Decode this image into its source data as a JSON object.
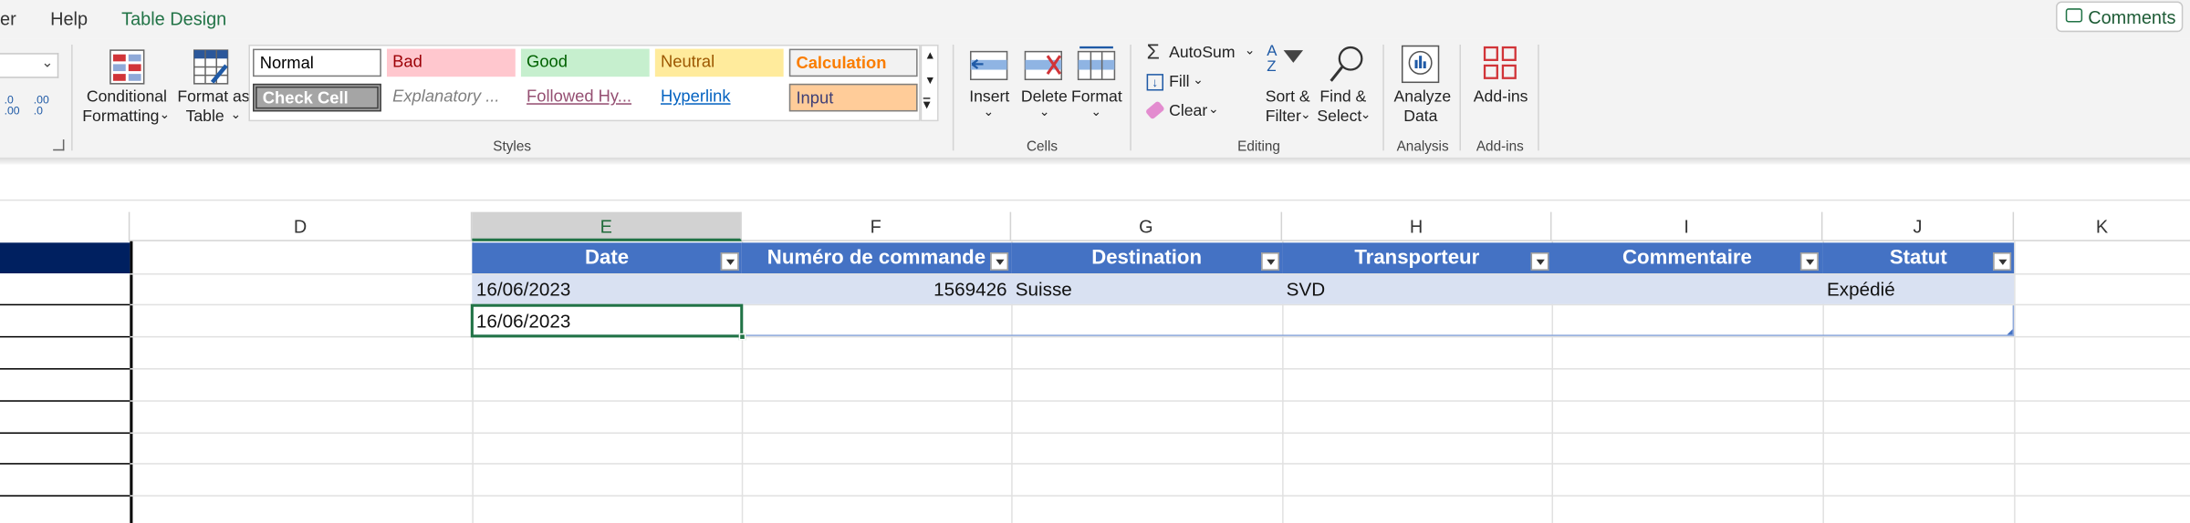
{
  "tabs": [
    "er",
    "Help",
    "Table Design"
  ],
  "comments_button": "Comments",
  "number_format": {
    "increase_decimal": ".0 .00",
    "decrease_decimal": ".00 .0"
  },
  "ribbon": {
    "conditional_formatting": [
      "Conditional",
      "Formatting"
    ],
    "format_as_table": [
      "Format as",
      "Table"
    ],
    "styles": [
      {
        "label": "Normal",
        "bg": "#ffffff",
        "color": "#000000"
      },
      {
        "label": "Bad",
        "bg": "#ffc7ce",
        "color": "#9c0006"
      },
      {
        "label": "Good",
        "bg": "#c6efce",
        "color": "#006100"
      },
      {
        "label": "Neutral",
        "bg": "#ffeb9c",
        "color": "#9c5700"
      },
      {
        "label": "Calculation",
        "bg": "#f2f2f2",
        "color": "#fa7d00"
      },
      {
        "label": "Check Cell",
        "bg": "#a5a5a5",
        "color": "#ffffff"
      },
      {
        "label": "Explanatory ...",
        "bg": "#f3f3f3",
        "color": "#7f7f7f"
      },
      {
        "label": "Followed Hy...",
        "bg": "#f3f3f3",
        "color": "#954f72"
      },
      {
        "label": "Hyperlink",
        "bg": "#f3f3f3",
        "color": "#0563c1"
      },
      {
        "label": "Input",
        "bg": "#ffcc99",
        "color": "#3f3f76"
      }
    ],
    "styles_group": "Styles",
    "cells": {
      "insert": "Insert",
      "delete": "Delete",
      "format": "Format",
      "group": "Cells"
    },
    "editing": {
      "autosum": "AutoSum",
      "fill": "Fill",
      "clear": "Clear",
      "sort_filter": [
        "Sort &",
        "Filter"
      ],
      "find_select": [
        "Find &",
        "Select"
      ],
      "group": "Editing"
    },
    "analysis": {
      "analyze_data": [
        "Analyze",
        "Data"
      ],
      "group": "Analysis"
    },
    "addins": {
      "addins": "Add-ins",
      "group": "Add-ins"
    }
  },
  "columns": [
    "D",
    "E",
    "F",
    "G",
    "H",
    "I",
    "J",
    "K"
  ],
  "table": {
    "headers": [
      "Date",
      "Numéro de commande",
      "Destination",
      "Transporteur",
      "Commentaire",
      "Statut"
    ],
    "rows": [
      [
        "16/06/2023",
        "1569426",
        "Suisse",
        "SVD",
        "",
        "Expédié"
      ],
      [
        "16/06/2023",
        "",
        "",
        "",
        "",
        ""
      ]
    ]
  },
  "colors": {
    "table_header": "#4472c4",
    "table_band": "#d9e1f2",
    "left_table_header": "#002060",
    "accent_green": "#217346"
  }
}
